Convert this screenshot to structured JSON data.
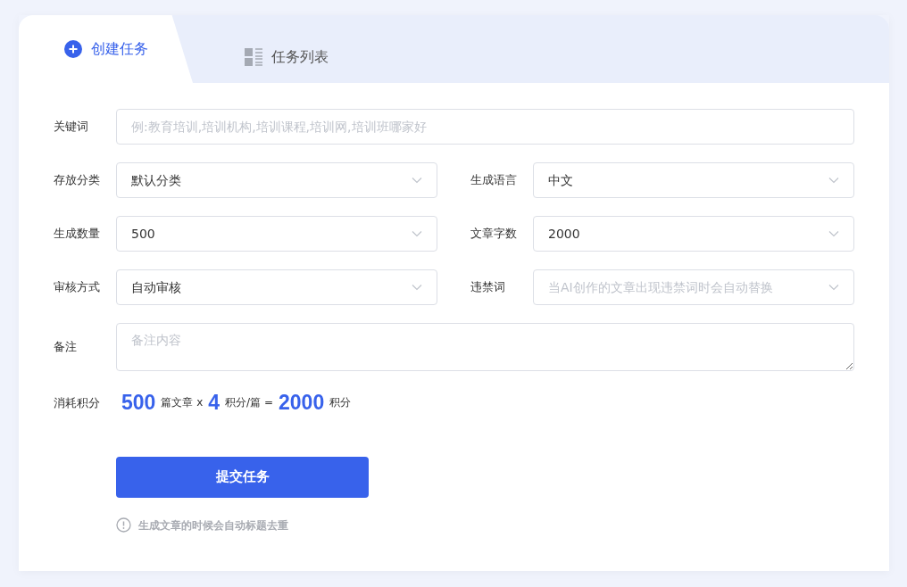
{
  "tabs": [
    {
      "label": "创建任务",
      "selected": true,
      "kind": "create"
    },
    {
      "label": "任务列表",
      "selected": false,
      "kind": "list"
    }
  ],
  "form": {
    "keyword": {
      "label": "关键词",
      "placeholder": "例:教育培训,培训机构,培训课程,培训网,培训班哪家好"
    },
    "selects": [
      {
        "label": "存放分类",
        "value": "默认分类"
      },
      {
        "label": "生成语言",
        "value": "中文"
      },
      {
        "label": "生成数量",
        "value": "500"
      },
      {
        "label": "文章字数",
        "value": "2000"
      },
      {
        "label": "审核方式",
        "value": "自动审核"
      },
      {
        "label": "违禁词",
        "placeholder": "当AI创作的文章出现违禁词时会自动替换"
      }
    ],
    "remark": {
      "label": "备注",
      "placeholder": "备注内容"
    },
    "cost": {
      "label": "消耗积分",
      "parts": [
        {
          "kind": "number",
          "text": "500"
        },
        {
          "kind": "text",
          "text": "篇文章 x"
        },
        {
          "kind": "number",
          "text": "4"
        },
        {
          "kind": "text",
          "text": "积分/篇 ="
        },
        {
          "kind": "number",
          "text": "2000"
        },
        {
          "kind": "text",
          "text": "积分"
        }
      ]
    },
    "submit": "提交任务",
    "tip": "生成文章的时候会自动标题去重"
  }
}
